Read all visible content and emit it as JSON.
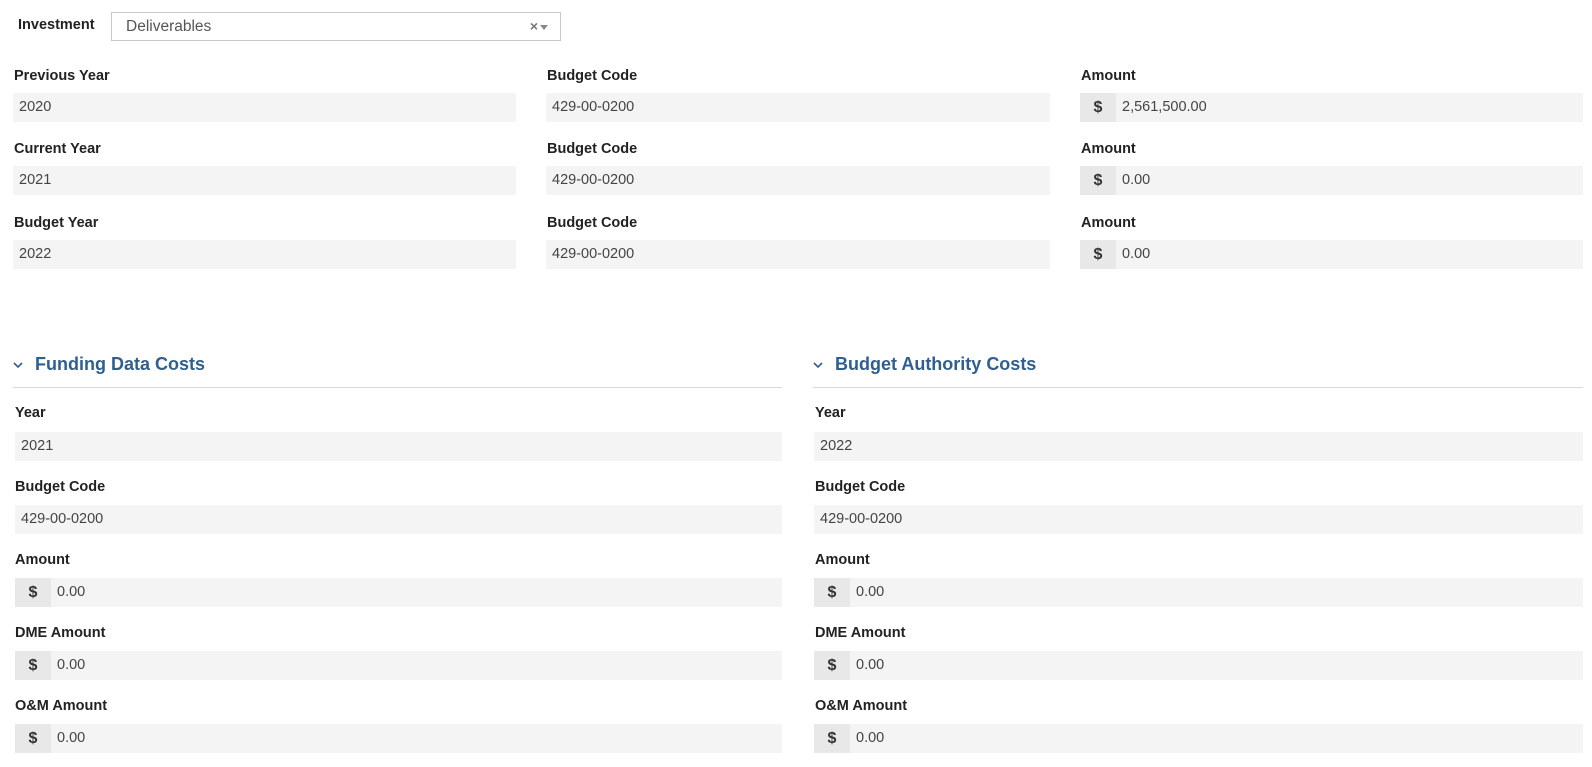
{
  "investment": {
    "label": "Investment",
    "value": "Deliverables",
    "clear_glyph": "×"
  },
  "year_rows": [
    {
      "year_label": "Previous Year",
      "year": "2020",
      "code_label": "Budget Code",
      "code": "429-00-0200",
      "amount_label": "Amount",
      "currency": "$",
      "amount": "2,561,500.00"
    },
    {
      "year_label": "Current Year",
      "year": "2021",
      "code_label": "Budget Code",
      "code": "429-00-0200",
      "amount_label": "Amount",
      "currency": "$",
      "amount": "0.00"
    },
    {
      "year_label": "Budget Year",
      "year": "2022",
      "code_label": "Budget Code",
      "code": "429-00-0200",
      "amount_label": "Amount",
      "currency": "$",
      "amount": "0.00"
    }
  ],
  "funding": {
    "title": "Funding Data Costs",
    "year_label": "Year",
    "year": "2021",
    "code_label": "Budget Code",
    "code": "429-00-0200",
    "amount_label": "Amount",
    "currency": "$",
    "amount": "0.00",
    "dme_label": "DME Amount",
    "dme": "0.00",
    "om_label": "O&M Amount",
    "om": "0.00"
  },
  "authority": {
    "title": "Budget Authority Costs",
    "year_label": "Year",
    "year": "2022",
    "code_label": "Budget Code",
    "code": "429-00-0200",
    "amount_label": "Amount",
    "currency": "$",
    "amount": "0.00",
    "dme_label": "DME Amount",
    "dme": "0.00",
    "om_label": "O&M Amount",
    "om": "0.00"
  },
  "colors": {
    "section_title": "#2f5f8f",
    "field_bg": "#f4f4f4",
    "addon_bg": "#e8e8e8"
  },
  "icons": {
    "section_toggle": "chevron-down-icon",
    "clear": "clear-icon",
    "dropdown": "caret-down-icon"
  }
}
